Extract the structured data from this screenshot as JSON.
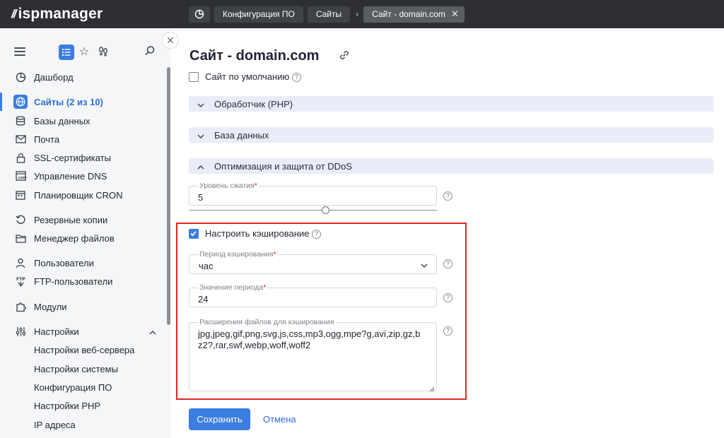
{
  "app": {
    "logo_mark": "//",
    "logo_text": "ispmanager"
  },
  "breadcrumbs": [
    {
      "label": "Конфигурация ПО"
    },
    {
      "label": "Сайты"
    },
    {
      "label": "Сайт - domain.com"
    }
  ],
  "colors": {
    "accent": "#3b7de0",
    "topbar": "#2d2f33",
    "highlight": "#e02424",
    "section_bg": "#e8edf8"
  },
  "sidebar": {
    "items": [
      {
        "label": "Дашборд",
        "icon": "pie-chart-icon"
      },
      {
        "label": "Сайты (2 из 10)",
        "icon": "globe-icon",
        "active": true
      },
      {
        "label": "Базы данных",
        "icon": "database-icon"
      },
      {
        "label": "Почта",
        "icon": "mail-icon"
      },
      {
        "label": "SSL-сертификаты",
        "icon": "lock-icon"
      },
      {
        "label": "Управление DNS",
        "icon": "dns-icon"
      },
      {
        "label": "Планировщик CRON",
        "icon": "calendar-icon"
      },
      {
        "label": "Резервные копии",
        "icon": "backup-icon"
      },
      {
        "label": "Менеджер файлов",
        "icon": "folder-icon"
      },
      {
        "label": "Пользователи",
        "icon": "user-icon"
      },
      {
        "label": "FTP-пользователи",
        "icon": "ftp-icon"
      },
      {
        "label": "Модули",
        "icon": "puzzle-icon"
      },
      {
        "label": "Настройки",
        "icon": "sliders-icon"
      }
    ],
    "settings_sub": [
      {
        "label": "Настройки веб-сервера"
      },
      {
        "label": "Настройки системы"
      },
      {
        "label": "Конфигурация ПО"
      },
      {
        "label": "Настройки PHP"
      },
      {
        "label": "IP адреса"
      }
    ]
  },
  "main": {
    "title": "Сайт - domain.com",
    "default_site": {
      "label": "Сайт по умолчанию",
      "checked": false,
      "help": "?"
    },
    "sections": [
      {
        "label": "Обработчик (PHP)",
        "expanded": false
      },
      {
        "label": "База данных",
        "expanded": false
      },
      {
        "label": "Оптимизация и защита от DDoS",
        "expanded": true
      }
    ],
    "compression": {
      "label": "Уровень сжатия",
      "required": "*",
      "value": "5",
      "slider_level": 5,
      "help": "?"
    },
    "caching": {
      "label": "Настроить кэширование",
      "checked": true,
      "help": "?",
      "period": {
        "label": "Период кэширования",
        "required": "*",
        "value": "час",
        "help": "?"
      },
      "period_value": {
        "label": "Значение периода",
        "required": "*",
        "value": "24",
        "help": "?"
      },
      "extensions": {
        "label": "Расширения файлов для кэширования",
        "value": "jpg,jpeg,gif,png,svg,js,css,mp3,ogg,mpe?g,avi,zip,gz,bz2?,rar,swf,webp,woff,woff2",
        "help": "?"
      }
    },
    "save_label": "Сохранить",
    "cancel_label": "Отмена"
  }
}
